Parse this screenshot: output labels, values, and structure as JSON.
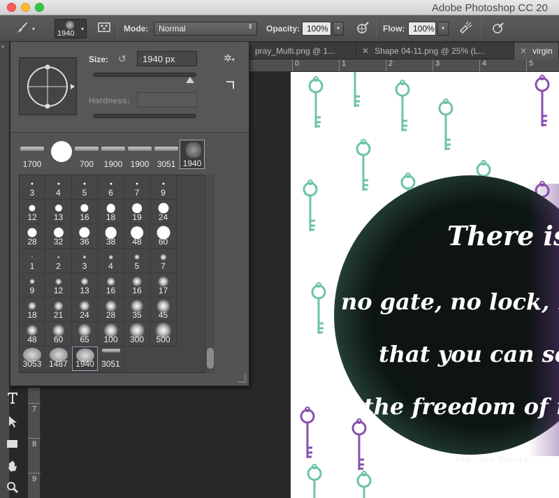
{
  "window": {
    "title": "Adobe Photoshop CC 20"
  },
  "options_bar": {
    "brush_preset_value": "1940",
    "mode_label": "Mode:",
    "mode_value": "Normal",
    "opacity_label": "Opacity:",
    "opacity_value": "100%",
    "flow_label": "Flow:",
    "flow_value": "100%"
  },
  "tabs": [
    {
      "label": "pray_Multi.png @ 1..."
    },
    {
      "label": "Shape 04-11.png @ 25% (L..."
    },
    {
      "label": "virgin"
    }
  ],
  "ruler_h": [
    "0",
    "1",
    "2",
    "3",
    "4",
    "5"
  ],
  "ruler_v": [
    "7",
    "8",
    "9"
  ],
  "brush_panel": {
    "size_label": "Size:",
    "size_value": "1940 px",
    "hardness_label": "Hardness:",
    "size_fraction": 0.94,
    "recent_brushes": [
      "1700",
      "",
      "700",
      "1900",
      "1900",
      "3051",
      "1940"
    ],
    "grid_rows": [
      [
        "3",
        "4",
        "5",
        "6",
        "7",
        "9"
      ],
      [
        "12",
        "13",
        "16",
        "18",
        "19",
        "24"
      ],
      [
        "28",
        "32",
        "36",
        "38",
        "48",
        "60"
      ],
      [
        "1",
        "2",
        "3",
        "4",
        "5",
        "7"
      ],
      [
        "9",
        "12",
        "13",
        "16",
        "16",
        "17"
      ],
      [
        "18",
        "21",
        "24",
        "28",
        "35",
        "45"
      ],
      [
        "48",
        "60",
        "65",
        "100",
        "300",
        "500"
      ],
      [
        "3053",
        "1487",
        "1940",
        "3051"
      ]
    ]
  },
  "document": {
    "quote_lines": [
      "There is",
      "no gate, no lock, no",
      "that you can set u",
      "the freedom of my"
    ],
    "author": "Virginia Woolf"
  },
  "colors": {
    "mint_key": "#6cc3a8",
    "purple_key": "#8a4fb0"
  },
  "icons": [
    "brush-icon",
    "brush-panel-toggle-icon",
    "airbrush-icon",
    "pressure-opacity-icon",
    "pressure-size-icon",
    "gear-icon",
    "reset-size-icon",
    "type-tool-icon",
    "selection-tool-icon",
    "rectangle-tool-icon",
    "hand-tool-icon",
    "zoom-tool-icon"
  ]
}
